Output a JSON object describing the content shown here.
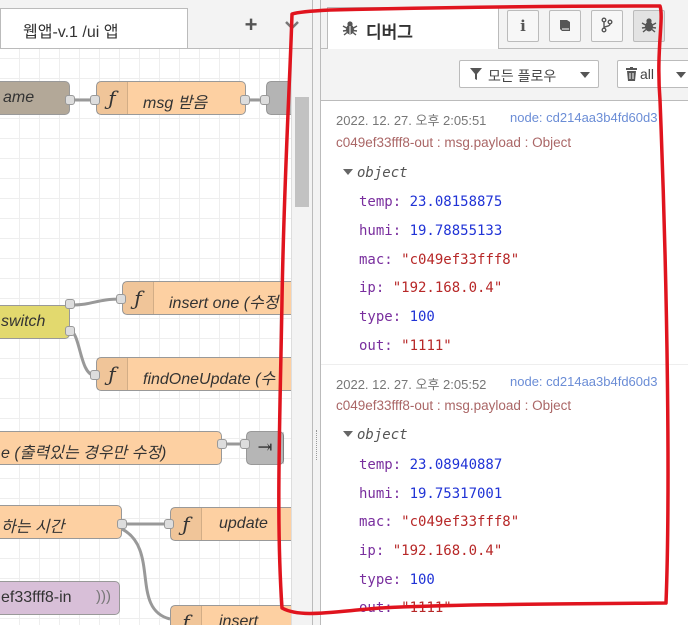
{
  "workspace": {
    "tab_label": "웹앱-v.1 /ui 앱",
    "add_tab_glyph": "+",
    "nodes": [
      {
        "label": "ame"
      },
      {
        "label": "msg 받음"
      },
      {
        "label": "switch"
      },
      {
        "label": "insert one (수정"
      },
      {
        "label": "findOneUpdate (수"
      },
      {
        "label": "e (출력있는 경우만 수정)"
      },
      {
        "label": "하는 시간"
      },
      {
        "label": "update"
      },
      {
        "label": "ef33fff8-in"
      },
      {
        "label": "insert"
      }
    ],
    "function_glyph": "ƒ"
  },
  "sidebar": {
    "tab_title": "디버그",
    "info_btn": "i",
    "filter_label": "모든 플로우",
    "clear_label": "all",
    "messages": [
      {
        "timestamp": "2022. 12. 27. 오후 2:05:51",
        "node": "node: cd214aa3b4fd60d3",
        "topic": "c049ef33fff8-out : msg.payload : Object",
        "type_label": "object",
        "props": [
          {
            "key": "temp",
            "value": "23.08158875",
            "kind": "num"
          },
          {
            "key": "humi",
            "value": "19.78855133",
            "kind": "num"
          },
          {
            "key": "mac",
            "value": "\"c049ef33fff8\"",
            "kind": "str"
          },
          {
            "key": "ip",
            "value": "\"192.168.0.4\"",
            "kind": "str"
          },
          {
            "key": "type",
            "value": "100",
            "kind": "num"
          },
          {
            "key": "out",
            "value": "\"1111\"",
            "kind": "str"
          }
        ]
      },
      {
        "timestamp": "2022. 12. 27. 오후 2:05:52",
        "node": "node: cd214aa3b4fd60d3",
        "topic": "c049ef33fff8-out : msg.payload : Object",
        "type_label": "object",
        "props": [
          {
            "key": "temp",
            "value": "23.08940887",
            "kind": "num"
          },
          {
            "key": "humi",
            "value": "19.75317001",
            "kind": "num"
          },
          {
            "key": "mac",
            "value": "\"c049ef33fff8\"",
            "kind": "str"
          },
          {
            "key": "ip",
            "value": "\"192.168.0.4\"",
            "kind": "str"
          },
          {
            "key": "type",
            "value": "100",
            "kind": "num"
          },
          {
            "key": "out",
            "value": "\"1111\"",
            "kind": "str"
          }
        ]
      }
    ]
  },
  "annotation": {
    "color": "#e0141e"
  }
}
